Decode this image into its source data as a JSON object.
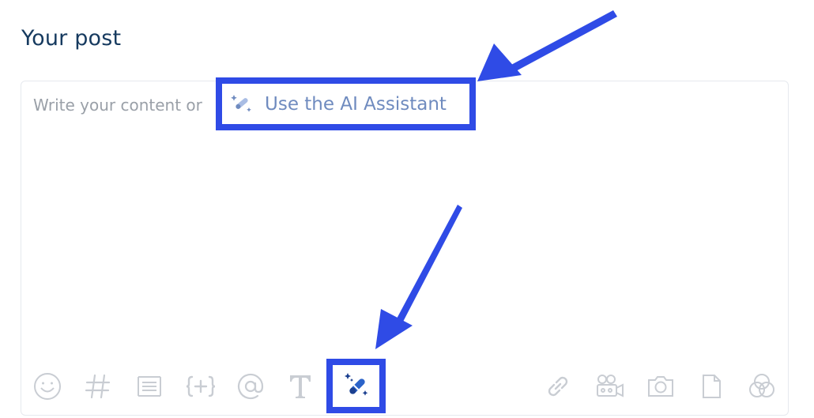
{
  "header": {
    "title": "Your post"
  },
  "editor": {
    "placeholder_prefix": "Write your content or",
    "ai_assistant_label": "Use the AI Assistant"
  },
  "toolbar": {
    "left_icons": [
      "emoji-icon",
      "hashtag-icon",
      "snippet-icon",
      "variable-icon",
      "mention-icon",
      "text-format-icon",
      "ai-magic-wand-icon"
    ],
    "right_icons": [
      "link-icon",
      "video-icon",
      "camera-icon",
      "document-icon",
      "color-circles-icon"
    ]
  },
  "colors": {
    "highlight": "#2f4be6",
    "title": "#163a5f",
    "icon_gray": "#c9cdd3",
    "ai_icon": "#2b63c9"
  }
}
